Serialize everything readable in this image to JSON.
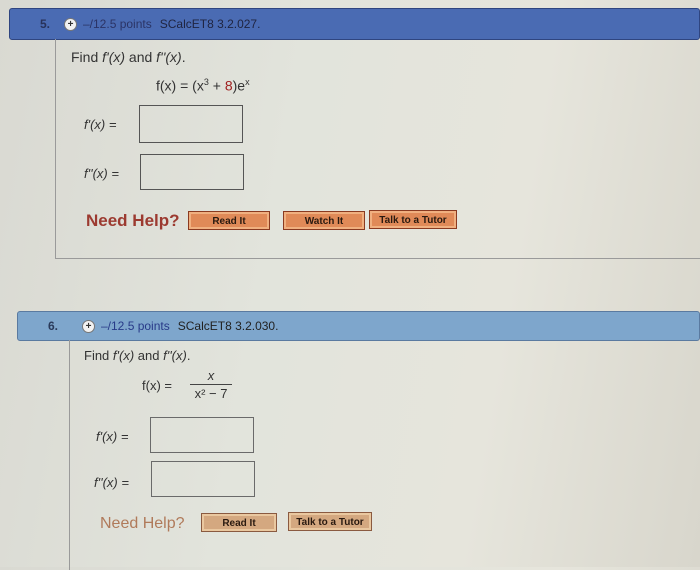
{
  "questions": [
    {
      "number": "5.",
      "points": "–/12.5 points",
      "code": "SCalcET8 3.2.027.",
      "prompt": {
        "find": "Find ",
        "fp": "f'(x)",
        "and": " and ",
        "fpp": "f''(x)",
        "end": "."
      },
      "function": {
        "lhs": "f(x) = (x",
        "exp": "3",
        "plus": " + ",
        "const": "8",
        "rest": ")e",
        "e_exp": "x"
      },
      "answers": [
        {
          "label": "f'(x) =",
          "value": ""
        },
        {
          "label": "f''(x) =",
          "value": ""
        }
      ],
      "help": {
        "label": "Need Help?",
        "buttons": [
          "Read It",
          "Watch It",
          "Talk to a Tutor"
        ]
      }
    },
    {
      "number": "6.",
      "points": "–/12.5 points",
      "code": "SCalcET8 3.2.030.",
      "prompt": {
        "find": "Find ",
        "fp": "f'(x)",
        "and": " and ",
        "fpp": "f''(x)",
        "end": "."
      },
      "function": {
        "lhs": "f(x) =",
        "numerator": "x",
        "denominator": "x² − 7"
      },
      "answers": [
        {
          "label": "f'(x) =",
          "value": ""
        },
        {
          "label": "f''(x) =",
          "value": ""
        }
      ],
      "help": {
        "label": "Need Help?",
        "buttons": [
          "Read It",
          "Talk to a Tutor"
        ]
      }
    }
  ],
  "colors": {
    "header_q5": "#4a6bb3",
    "header_q6": "#7ea6cc",
    "need_help": "#9c3a30",
    "button_fill": "#e08a58",
    "constant_highlight": "#a02020"
  }
}
